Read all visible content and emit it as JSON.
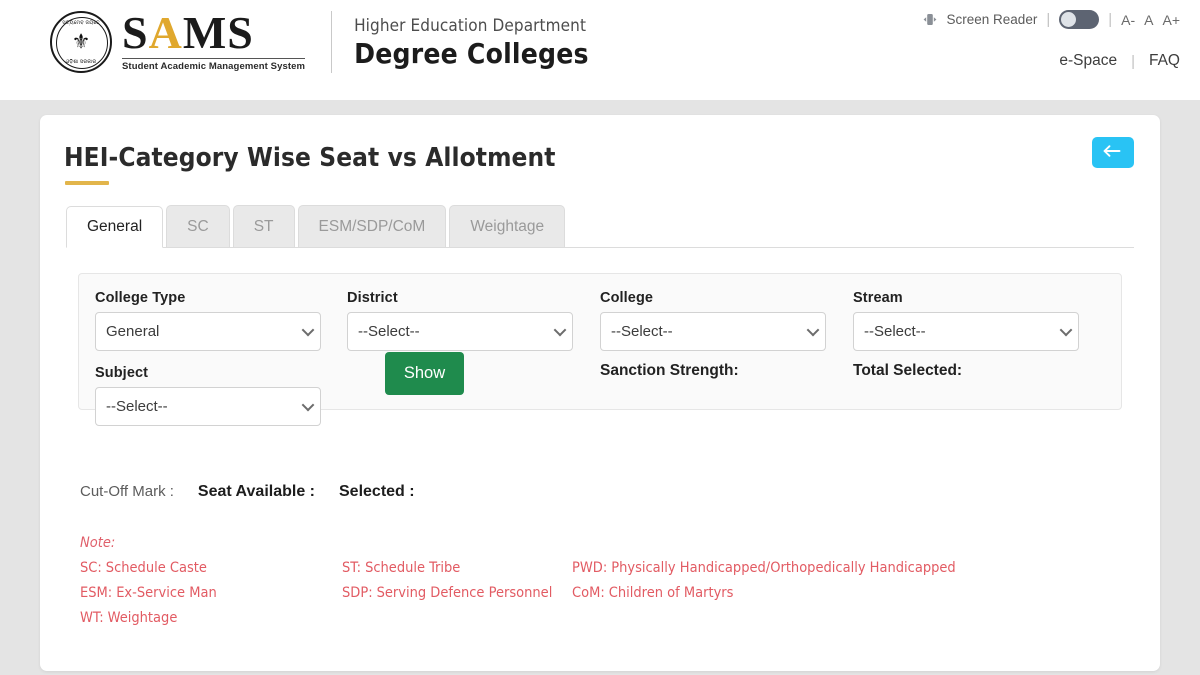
{
  "header": {
    "logo": {
      "acronym_s1": "S",
      "acronym_a": "A",
      "acronym_ms": "MS",
      "full_name": "Student Academic Management System",
      "emblem_top_text": "ସତ୍ୟମେବ ଜୟତେ",
      "emblem_bottom_text": "ଓଡ଼ିଶା ସରକାର",
      "emblem_icon": "state-emblem-lion"
    },
    "department_small": "Higher Education Department",
    "department_large": "Degree Colleges",
    "screen_reader_label": "Screen Reader",
    "screen_reader_icon": "speaker-icon",
    "screen_reader_enabled": false,
    "font_decrease": "A-",
    "font_normal": "A",
    "font_increase": "A+",
    "links": [
      {
        "label": "e-Space"
      },
      {
        "label": "FAQ"
      }
    ]
  },
  "page": {
    "title": "HEI-Category Wise Seat vs Allotment",
    "back_icon": "arrow-left-icon",
    "accent_color": "#e2b54b",
    "back_button_color": "#29c3f4"
  },
  "tabs": [
    {
      "label": "General",
      "active": true
    },
    {
      "label": "SC",
      "active": false
    },
    {
      "label": "ST",
      "active": false
    },
    {
      "label": "ESM/SDP/CoM",
      "active": false
    },
    {
      "label": "Weightage",
      "active": false
    }
  ],
  "filters": {
    "college_type": {
      "label": "College Type",
      "value": "General"
    },
    "district": {
      "label": "District",
      "value": "--Select--"
    },
    "college": {
      "label": "College",
      "value": "--Select--"
    },
    "stream": {
      "label": "Stream",
      "value": "--Select--"
    },
    "subject": {
      "label": "Subject",
      "value": "--Select--"
    },
    "show_button": "Show",
    "show_button_color": "#1f8b4d",
    "sanction_strength_label": "Sanction Strength:",
    "sanction_strength_value": "",
    "total_selected_label": "Total Selected:",
    "total_selected_value": ""
  },
  "summary": {
    "cutoff_label": "Cut-Off Mark :",
    "cutoff_value": "",
    "seat_available_label": "Seat Available :",
    "seat_available_value": "",
    "selected_label": "Selected :",
    "selected_value": ""
  },
  "notes": {
    "title": "Note:",
    "color": "#e25b63",
    "rows": [
      [
        {
          "abbr": "SC:",
          "text": "Schedule Caste"
        },
        {
          "abbr": "ST:",
          "text": "Schedule Tribe"
        },
        {
          "abbr": "PWD:",
          "text": "Physically Handicapped/Orthopedically Handicapped"
        }
      ],
      [
        {
          "abbr": "ESM:",
          "text": "Ex-Service Man"
        },
        {
          "abbr": "SDP:",
          "text": "Serving Defence Personnel"
        },
        {
          "abbr": "CoM:",
          "text": "Children of Martyrs"
        }
      ],
      [
        {
          "abbr": "WT:",
          "text": "Weightage"
        }
      ]
    ]
  }
}
